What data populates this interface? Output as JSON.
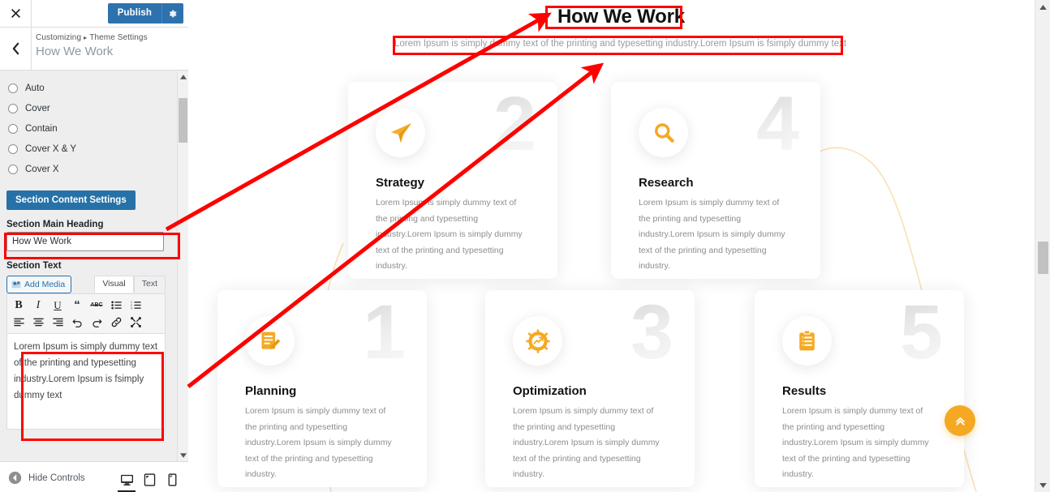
{
  "customizer": {
    "close_icon": "close-icon",
    "publish_label": "Publish",
    "gear_icon": "gear-icon",
    "back_icon": "chevron-left-icon",
    "breadcrumb_root": "Customizing",
    "breadcrumb_sep": "▸",
    "breadcrumb_section": "Theme Settings",
    "panel_title": "How We Work",
    "background_size_options": [
      {
        "label": "Auto",
        "selected": false
      },
      {
        "label": "Cover",
        "selected": false
      },
      {
        "label": "Contain",
        "selected": false
      },
      {
        "label": "Cover X & Y",
        "selected": false
      },
      {
        "label": "Cover X",
        "selected": false
      }
    ],
    "section_content_button": "Section Content Settings",
    "main_heading_label": "Section Main Heading",
    "main_heading_value": "How We Work",
    "section_text_label": "Section Text",
    "add_media_label": "Add Media",
    "editor_tabs": [
      {
        "label": "Visual",
        "active": true
      },
      {
        "label": "Text",
        "active": false
      }
    ],
    "toolbar_buttons": [
      {
        "name": "bold-icon",
        "glyph": "B"
      },
      {
        "name": "italic-icon",
        "glyph": "I"
      },
      {
        "name": "underline-icon",
        "glyph": "U"
      },
      {
        "name": "blockquote-icon",
        "glyph": "“"
      },
      {
        "name": "strikethrough-icon",
        "glyph": "ABC"
      },
      {
        "name": "bulleted-list-icon",
        "glyph": "☰"
      },
      {
        "name": "numbered-list-icon",
        "glyph": "☰"
      },
      {
        "name": "align-left-icon",
        "glyph": "≡"
      },
      {
        "name": "align-center-icon",
        "glyph": "≡"
      },
      {
        "name": "align-right-icon",
        "glyph": "≡"
      },
      {
        "name": "undo-icon",
        "glyph": "↶"
      },
      {
        "name": "redo-icon",
        "glyph": "↷"
      },
      {
        "name": "insert-link-icon",
        "glyph": "🔗"
      },
      {
        "name": "fullscreen-icon",
        "glyph": "✕"
      }
    ],
    "editor_content": "Lorem Ipsum is simply dummy text of the printing and typesetting industry.Lorem Ipsum is fsimply dummy text",
    "footer": {
      "hide_controls_label": "Hide Controls",
      "devices": [
        {
          "name": "desktop-preview-button",
          "active": true
        },
        {
          "name": "tablet-preview-button",
          "active": false
        },
        {
          "name": "mobile-preview-button",
          "active": false
        }
      ]
    }
  },
  "preview": {
    "section_heading": "How We Work",
    "section_text": "Lorem Ipsum is simply dummy text of the printing and typesetting industry.Lorem Ipsum is fsimply dummy text",
    "body_text": "Lorem Ipsum is simply dummy text of the printing and typesetting industry.Lorem Ipsum is simply dummy text of the printing and typesetting industry.",
    "cards": [
      {
        "number": "2",
        "title": "Strategy",
        "icon": "paper-plane-icon",
        "text": "Lorem Ipsum is simply dummy text of the printing and typesetting industry.Lorem Ipsum is simply dummy text of the printing and typesetting industry."
      },
      {
        "number": "4",
        "title": "Research",
        "icon": "magnifier-icon",
        "text": "Lorem Ipsum is simply dummy text of the printing and typesetting industry.Lorem Ipsum is simply dummy text of the printing and typesetting industry."
      },
      {
        "number": "1",
        "title": "Planning",
        "icon": "edit-document-icon",
        "text": "Lorem Ipsum is simply dummy text of the printing and typesetting industry.Lorem Ipsum is simply dummy text of the printing and typesetting industry."
      },
      {
        "number": "3",
        "title": "Optimization",
        "icon": "gear-chart-icon",
        "text": "Lorem Ipsum is simply dummy text of the printing and typesetting industry.Lorem Ipsum is simply dummy text of the printing and typesetting industry."
      },
      {
        "number": "5",
        "title": "Results",
        "icon": "clipboard-check-icon",
        "text": "Lorem Ipsum is simply dummy text of the printing and typesetting industry.Lorem Ipsum is simply dummy text of the printing and typesetting industry."
      }
    ],
    "scroll_top_icon": "double-chevron-up-icon"
  },
  "colors": {
    "accent_orange": "#f5a922",
    "publish_blue": "#2e72ad",
    "section_button_blue": "#2672a8",
    "annotation_red": "#ff0000",
    "card_number_grey": "#e6e6e6"
  }
}
